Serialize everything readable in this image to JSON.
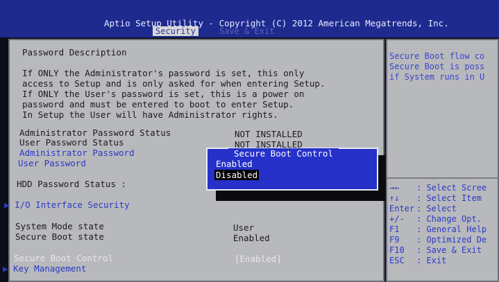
{
  "header": {
    "title": "Aptio Setup Utility - Copyright (C) 2012 American Megatrends, Inc.",
    "tabs": [
      {
        "label": "Security",
        "active": true
      },
      {
        "label": "Save & Exit",
        "active": false
      }
    ]
  },
  "main": {
    "section_title": "Password Description",
    "description_lines": [
      "If ONLY the Administrator's password is set, this only",
      "access to Setup and is only asked for when entering Setup.",
      "If ONLY the User's password is set, this is a power on",
      "password and must be entered to boot to enter Setup.",
      "In Setup the User will have Administrator rights."
    ],
    "rows": {
      "admin_status_label": "Administrator Password Status",
      "admin_status_value": "NOT INSTALLED",
      "user_status_label": "User Password Status",
      "user_status_value": "NOT INSTALLED",
      "admin_password": "Administrator Password",
      "user_password": "User Password",
      "hdd_status_label": "HDD Password Status   :",
      "io_security": "I/O Interface Security",
      "system_mode_label": "System Mode state",
      "system_mode_value": "User",
      "secure_boot_state_label": "Secure Boot state",
      "secure_boot_state_value": "Enabled",
      "secure_boot_control_label": "Secure Boot Control",
      "secure_boot_control_value": "[Enabled]",
      "key_management": "Key Management"
    },
    "arrow": "▶"
  },
  "popup": {
    "title": "Secure Boot Control",
    "options": [
      "Enabled",
      "Disabled"
    ],
    "selected": "Disabled"
  },
  "help": {
    "description": [
      "Secure Boot flow co",
      "Secure Boot is poss",
      "if System runs in U"
    ],
    "keys": [
      {
        "key": "→←",
        "action": ": Select Scree"
      },
      {
        "key": "↑↓",
        "action": ": Select Item"
      },
      {
        "key": "Enter",
        "action": ": Select"
      },
      {
        "key": "+/-",
        "action": ": Change Opt."
      },
      {
        "key": "F1",
        "action": ": General Help"
      },
      {
        "key": "F9",
        "action": ": Optimized De"
      },
      {
        "key": "F10",
        "action": ": Save & Exit"
      },
      {
        "key": "ESC",
        "action": ": Exit"
      }
    ]
  }
}
